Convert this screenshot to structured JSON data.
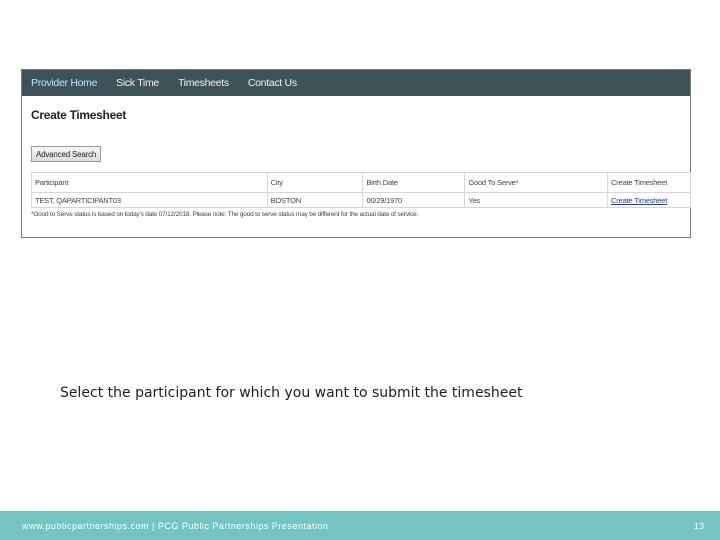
{
  "app": {
    "nav": [
      {
        "label": "Provider Home"
      },
      {
        "label": "Sick Time"
      },
      {
        "label": "Timesheets"
      },
      {
        "label": "Contact Us"
      }
    ],
    "page_title": "Create Timesheet",
    "advanced_search_label": "Advanced Search",
    "table": {
      "headers": [
        "Participant",
        "City",
        "Birth Date",
        "Good To Serve*",
        "Create Timesheet"
      ],
      "rows": [
        {
          "participant": "TEST, QAPARTICIPANT03",
          "city": "BOSTON",
          "birth_date": "00/29/1970",
          "good_to_serve": "Yes",
          "create_link": "Create Timesheet"
        }
      ]
    },
    "note": "*Good to Serve status is based on today's date 07/12/2018. Please note: The good to serve status may be different for the actual date of service."
  },
  "caption": "Select the participant for which you want to submit the timesheet",
  "footer": {
    "text": "www.publicpartnerships.com | PCG Public Partnerships Presentation",
    "page": "13"
  }
}
